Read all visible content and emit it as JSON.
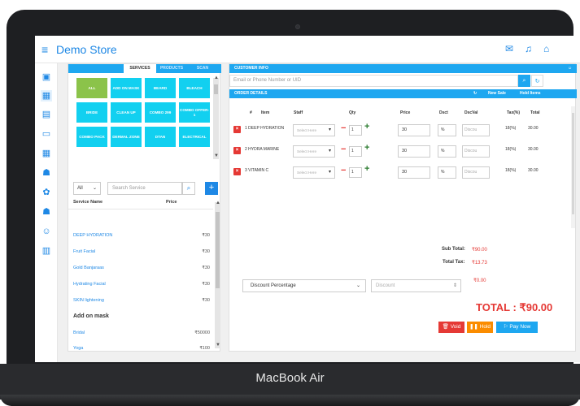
{
  "device": {
    "brand": "MacBook Air"
  },
  "app": {
    "title": "Demo Store",
    "menu_icon": "≡"
  },
  "topbar_icons": [
    "mail-icon",
    "bell-icon",
    "home-icon"
  ],
  "sidebar_icons": [
    "register-icon",
    "sales-icon",
    "calendar-icon",
    "monitor-icon",
    "building-icon",
    "users-icon",
    "settings-icon",
    "group-icon",
    "user-icon",
    "chart-icon"
  ],
  "left_tabs": [
    "SERVICES",
    "PRODUCTS",
    "SCAN"
  ],
  "categories": [
    "ALL",
    "ADD ON MASK",
    "BEARD",
    "BLEACH",
    "BRIDE",
    "CLEAN UP",
    "COMBO 299",
    "COMBO OFFER-1",
    "COMBO PACK",
    "DERMAL ZONE",
    "DTAN",
    "ELECTRICAL"
  ],
  "filter": {
    "select_value": "All",
    "search_placeholder": "Search Service"
  },
  "service_table": {
    "headers": [
      "Service Name",
      "Price"
    ],
    "rows": [
      {
        "name": "DEEP HYDRATION",
        "price": "₹30"
      },
      {
        "name": "Fruit Facial",
        "price": "₹30"
      },
      {
        "name": "Gold Banjaraas",
        "price": "₹30"
      },
      {
        "name": "Hydrating Facial",
        "price": "₹30"
      },
      {
        "name": "SKIN lightening",
        "price": "₹30"
      },
      {
        "name": "Add on mask",
        "price": ""
      },
      {
        "name": "Bridal",
        "price": "₹50000"
      },
      {
        "name": "Yoga",
        "price": "₹100"
      }
    ]
  },
  "customer": {
    "header": "CUSTOMER INFO",
    "placeholder": "Email or Phone Number or UID"
  },
  "order": {
    "header": "ORDER DETAILS",
    "new_sale": "New Sale",
    "hold_items": "Hold Items",
    "columns": [
      "#",
      "Item",
      "Staff",
      "Qty",
      "Price",
      "Dsct",
      "DscVal",
      "Tax(%)",
      "Total"
    ],
    "rows": [
      {
        "idx": "1",
        "item": "DEEP HYDRATION",
        "staff": "Select Here",
        "qty": "1",
        "price": "30",
        "dsct": "%",
        "dscval": "Discou",
        "tax": "18(%)",
        "total": "30.00"
      },
      {
        "idx": "2",
        "item": "HYDRA MARINE",
        "staff": "Select Here",
        "qty": "1",
        "price": "30",
        "dsct": "%",
        "dscval": "Discou",
        "tax": "18(%)",
        "total": "30.00"
      },
      {
        "idx": "3",
        "item": "VITAMIN C",
        "staff": "Select Here",
        "qty": "1",
        "price": "30",
        "dsct": "%",
        "dscval": "Discou",
        "tax": "18(%)",
        "total": "30.00"
      }
    ]
  },
  "summary": {
    "subtotal_label": "Sub Total:",
    "subtotal_value": "₹90.00",
    "tax_label": "Total Tax:",
    "tax_value": "₹13.73",
    "discount_type": "Discount Percentage",
    "discount_placeholder": "Discount",
    "discount_value": "₹0.00",
    "total": "TOTAL : ₹90.00"
  },
  "actions": {
    "void": "Void",
    "hold": "Hold",
    "pay": "Pay Now"
  },
  "colors": {
    "accent": "#1ea7f0",
    "danger": "#e53935",
    "hold": "#fb8c00",
    "all_tile": "#8bc34a",
    "tile": "#12d0f0"
  }
}
